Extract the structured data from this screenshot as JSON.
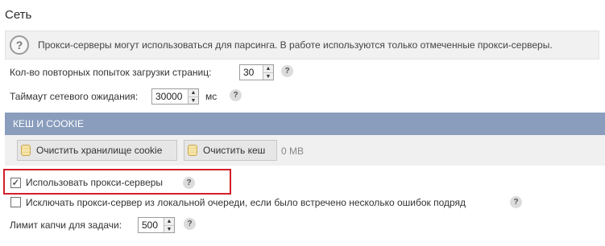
{
  "section": {
    "title": "Сеть"
  },
  "info": {
    "icon": "question-icon",
    "text": "Прокси-серверы могут использоваться для парсинга. В работе используются только отмеченные прокси-серверы."
  },
  "retries": {
    "label": "Кол-во повторных попыток загрузки страниц:",
    "value": "30",
    "help_glyph": "?"
  },
  "timeout": {
    "label": "Таймаут сетевого ожидания:",
    "value": "30000",
    "unit": "мс",
    "help_glyph": "?"
  },
  "cache": {
    "title": "КЕШ И COOKIE",
    "clear_cookie_label": "Очистить хранилище cookie",
    "clear_cache_label": "Очистить кеш",
    "size": "0 MB"
  },
  "use_proxy": {
    "label": "Использовать прокси-серверы",
    "checked": true,
    "check_glyph": "✓",
    "help_glyph": "?"
  },
  "exclude_proxy": {
    "label": "Исключать прокси-сервер из локальной очереди, если было встречено несколько ошибок подряд",
    "checked": false,
    "help_glyph": "?"
  },
  "captcha": {
    "label": "Лимит капчи для задачи:",
    "value": "500",
    "help_glyph": "?"
  },
  "spin_glyphs": {
    "up": "▲",
    "down": "▼"
  },
  "colors": {
    "cache_header": "#8a9dbd",
    "highlight_frame": "#d21f2a"
  }
}
